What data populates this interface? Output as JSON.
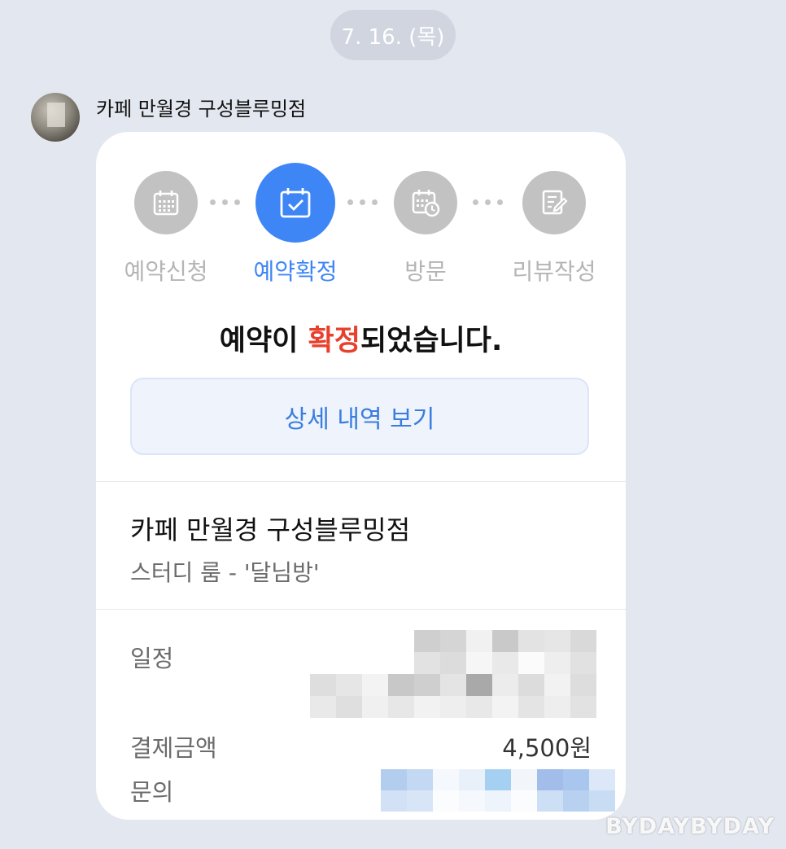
{
  "chat": {
    "date": "7. 16. (목)",
    "sender": {
      "name": "카페 만월경 구성블루밍점"
    }
  },
  "card": {
    "steps": [
      {
        "label": "예약신청",
        "icon": "calendar-grid-icon",
        "active": false
      },
      {
        "label": "예약확정",
        "icon": "calendar-check-icon",
        "active": true
      },
      {
        "label": "방문",
        "icon": "calendar-clock-icon",
        "active": false
      },
      {
        "label": "리뷰작성",
        "icon": "review-edit-icon",
        "active": false
      }
    ],
    "confirm": {
      "before": "예약이 ",
      "highlight": "확정",
      "after": "되었습니다."
    },
    "detail_button": "상세 내역 보기",
    "store_name": "카페 만월경 구성블루밍점",
    "room_name": "스터디 룸 - '달님방'",
    "info": {
      "schedule_label": "일정",
      "payment_label": "결제금액",
      "payment_value": "4,500원",
      "contact_label": "문의"
    }
  },
  "watermark": "BYDAYBYDAY",
  "colors": {
    "background": "#e3e7ef",
    "accent_blue": "#3e86f5",
    "highlight_red": "#e8402c",
    "inactive_gray": "#c2c2c2"
  }
}
